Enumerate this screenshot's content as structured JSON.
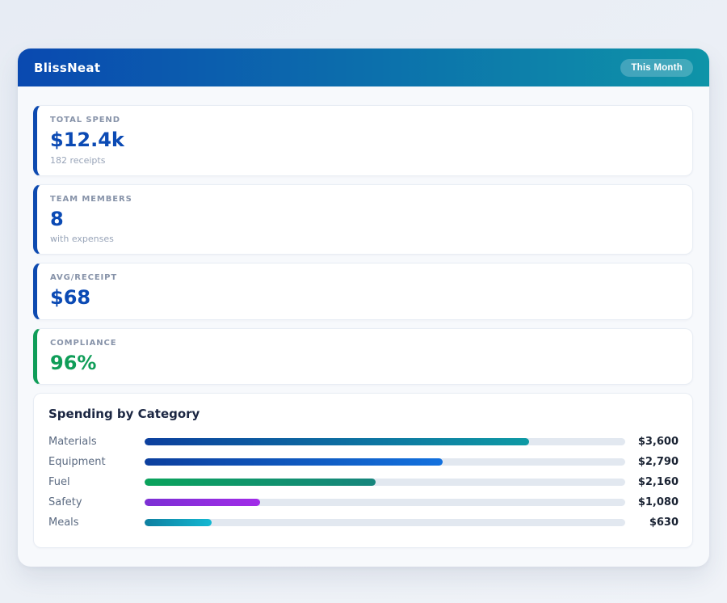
{
  "header": {
    "title": "BlissNeat",
    "badge": "This Month"
  },
  "stats": [
    {
      "label": "TOTAL SPEND",
      "value": "$12.4k",
      "subtitle": "182 receipts",
      "accent": "#0d4ab0",
      "value_color": "#0b4ab4"
    },
    {
      "label": "TEAM MEMBERS",
      "value": "8",
      "subtitle": "with expenses",
      "accent": "#0d4ab0",
      "value_color": "#0b4ab4"
    },
    {
      "label": "AVG/RECEIPT",
      "value": "$68",
      "subtitle": "",
      "accent": "#0d4ab0",
      "value_color": "#0b4ab4"
    },
    {
      "label": "COMPLIANCE",
      "value": "96%",
      "subtitle": "",
      "accent": "#0f9d58",
      "value_color": "#0f9d58"
    }
  ],
  "chart_data": {
    "type": "bar",
    "orientation": "horizontal",
    "title": "Spending by Category",
    "categories": [
      "Materials",
      "Equipment",
      "Fuel",
      "Safety",
      "Meals"
    ],
    "values": [
      3600,
      2790,
      2160,
      1080,
      630
    ],
    "xlim": [
      0,
      4500
    ],
    "grid": false,
    "legend": false,
    "track_color": "#e2e8f0",
    "rows": [
      {
        "label": "Materials",
        "value": 3600,
        "value_label": "$3,600",
        "percent": 80,
        "color_start": "#0c3f9e",
        "color_end": "#0e9aa4"
      },
      {
        "label": "Equipment",
        "value": 2790,
        "value_label": "$2,790",
        "percent": 62,
        "color_start": "#0c3f9e",
        "color_end": "#1371de"
      },
      {
        "label": "Fuel",
        "value": 2160,
        "value_label": "$2,160",
        "percent": 48,
        "color_start": "#0aa35c",
        "color_end": "#17857d"
      },
      {
        "label": "Safety",
        "value": 1080,
        "value_label": "$1,080",
        "percent": 24,
        "color_start": "#7c2fd4",
        "color_end": "#a12ce8"
      },
      {
        "label": "Meals",
        "value": 630,
        "value_label": "$630",
        "percent": 14,
        "color_start": "#0e7fa0",
        "color_end": "#14b8d2"
      }
    ]
  }
}
